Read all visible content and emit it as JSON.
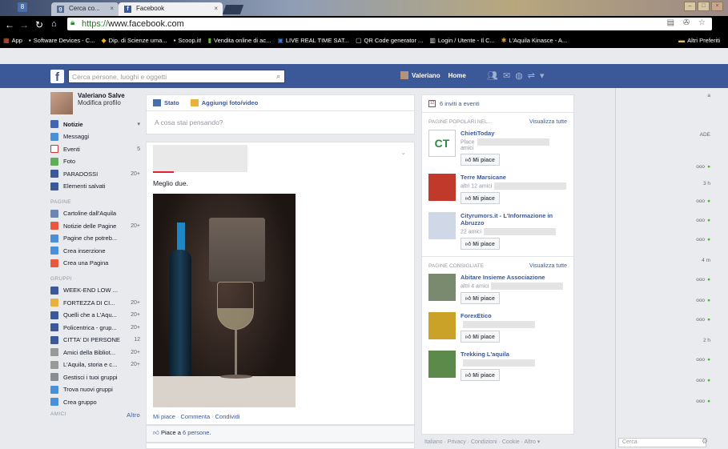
{
  "browser": {
    "tabs": [
      "Cerca co...",
      "Facebook"
    ],
    "url_proto": "https://",
    "url_host": "www.facebook.com",
    "bookmarks": [
      "App",
      "Software Devices - C...",
      "Dip. di Scienze uma...",
      "Scoop.it!",
      "Vendita online di ac...",
      "LIVE REAL TIME SAT...",
      "QR Code generator ...",
      "Login / Utente - Il C...",
      "L'Aquila Kinasce - A...",
      "Altri Preferiti"
    ]
  },
  "fbbar": {
    "search_placeholder": "Cerca persone, luoghi e oggetti",
    "user": "Valeriano",
    "home": "Home"
  },
  "leftnav": {
    "name": "Valeriano Salve",
    "edit": "Modifica profilo",
    "items": [
      {
        "label": "Notizie",
        "count": "▾",
        "icon": "news-icon",
        "color": "#4267b2"
      },
      {
        "label": "Messaggi",
        "count": "",
        "icon": "messages-icon",
        "color": "#4a8fd9"
      },
      {
        "label": "Eventi",
        "count": "5",
        "icon": "calendar-icon",
        "color": "#ffffff"
      },
      {
        "label": "Foto",
        "count": "",
        "icon": "photo-icon",
        "color": "#5fae59"
      },
      {
        "label": "PARADOSSI",
        "count": "20+",
        "icon": "group-icon",
        "color": "#3b5998"
      },
      {
        "label": "Elementi salvati",
        "count": "",
        "icon": "saved-icon",
        "color": "#3b5998"
      }
    ],
    "pages_header": "PAGINE",
    "pages": [
      {
        "label": "Cartoline dall'Aquila",
        "count": "",
        "icon": "page-icon",
        "color": "#6d84b4"
      },
      {
        "label": "Notizie delle Pagine",
        "count": "20+",
        "icon": "megaphone-icon",
        "color": "#e9573f"
      },
      {
        "label": "Pagine che potreb...",
        "count": "",
        "icon": "flag-icon",
        "color": "#4a8fd9"
      },
      {
        "label": "Crea inserzione",
        "count": "",
        "icon": "ad-icon",
        "color": "#4a8fd9"
      },
      {
        "label": "Crea una Pagina",
        "count": "",
        "icon": "plus-icon",
        "color": "#e9573f"
      }
    ],
    "groups_header": "GRUPPI",
    "groups": [
      {
        "label": "WEEK-END LOW ...",
        "count": "",
        "icon": "group-icon",
        "color": "#3b5998"
      },
      {
        "label": "FORTEZZA DI CI...",
        "count": "20+",
        "icon": "fortress-icon",
        "color": "#e8b03c"
      },
      {
        "label": "Quelli che a L'Aqu...",
        "count": "20+",
        "icon": "group-icon",
        "color": "#3b5998"
      },
      {
        "label": "Policentrica - grup...",
        "count": "20+",
        "icon": "group-icon",
        "color": "#3b5998"
      },
      {
        "label": "CITTA' DI PERSONE",
        "count": "12",
        "icon": "group-icon",
        "color": "#3b5998"
      },
      {
        "label": "Amici della Bibliot...",
        "count": "20+",
        "icon": "book-icon",
        "color": "#999999"
      },
      {
        "label": "L'Aquila, storia e c...",
        "count": "20+",
        "icon": "book-icon",
        "color": "#999999"
      },
      {
        "label": "Gestisci i tuoi gruppi",
        "count": "",
        "icon": "manage-icon",
        "color": "#8a8d91"
      },
      {
        "label": "Trova nuovi gruppi",
        "count": "",
        "icon": "find-icon",
        "color": "#4a8fd9"
      },
      {
        "label": "Crea gruppo",
        "count": "",
        "icon": "plus-icon",
        "color": "#4a8fd9"
      }
    ],
    "friends_header": "AMICI",
    "friends_more": "Altro"
  },
  "composer": {
    "status": "Stato",
    "add_photo": "Aggiungi foto/video",
    "prompt": "A cosa stai pensando?"
  },
  "post": {
    "text": "Meglio due.",
    "like": "Mi piace",
    "comment": "Commenta",
    "share": "Condividi",
    "likes_prefix": "Piace a ",
    "likes_count": "6 persone",
    "likes_suffix": "."
  },
  "rightcol": {
    "events": "6 inviti a eventi",
    "popular_header": "PAGINE POPOLARI NEL...",
    "see_all": "Visualizza tutte",
    "popular": [
      {
        "name": "ChietiToday",
        "meta": "Place",
        "meta2": "amici",
        "thumb": "#ffffff"
      },
      {
        "name": "Terre Marsicane",
        "meta": "altri 12 amici",
        "meta2": "",
        "thumb": "#c0392b"
      },
      {
        "name": "Cityrumors.it - L'Informazione in Abruzzo",
        "meta": "22 amici",
        "meta2": "",
        "thumb": "#d0d8e8"
      }
    ],
    "suggested_header": "PAGINE CONSIGLIATE",
    "suggested": [
      {
        "name": "Abitare Insieme Associazione",
        "meta": "altri 4 amici",
        "meta2": "",
        "thumb": "#7a8a6e"
      },
      {
        "name": "ForexEtico",
        "meta": "",
        "meta2": "",
        "thumb": "#c9a227"
      },
      {
        "name": "Trekking L'aquila",
        "meta": "",
        "meta2": "",
        "thumb": "#5b8a4a"
      }
    ],
    "like_btn": "Mi piace",
    "footer": "Italiano · Privacy · Condizioni · Cookie · Altro ▾"
  },
  "chat": {
    "search_placeholder": "Cerca",
    "statuses": [
      "ADE",
      "3 h",
      "4 m",
      "2 h"
    ]
  }
}
